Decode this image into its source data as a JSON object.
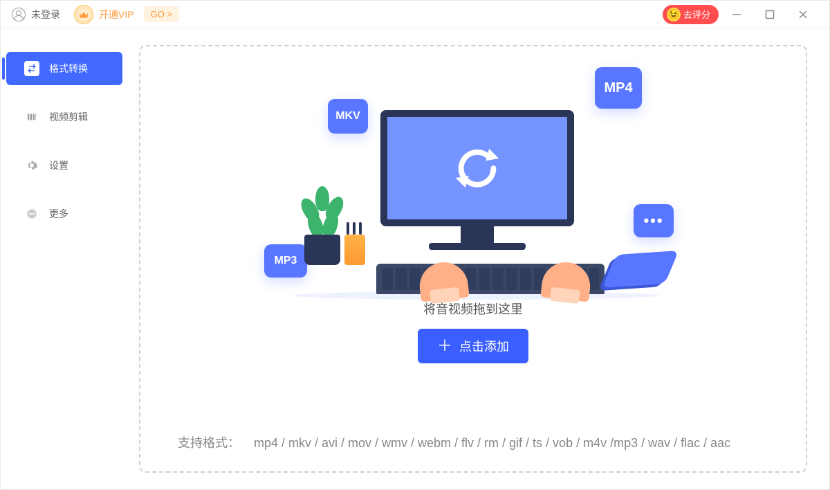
{
  "titlebar": {
    "login_status": "未登录",
    "vip_label": "开通VIP",
    "go_label": "GO >",
    "rate_label": "去评分"
  },
  "sidebar": {
    "items": [
      {
        "label": "格式转换"
      },
      {
        "label": "视频剪辑"
      },
      {
        "label": "设置"
      },
      {
        "label": "更多"
      }
    ]
  },
  "main": {
    "format_tags": {
      "mkv": "MKV",
      "mp4": "MP4",
      "mp3": "MP3",
      "more": "•••"
    },
    "drag_hint": "将音视频拖到这里",
    "add_button": "点击添加",
    "supported_label": "支持格式：",
    "supported_formats": "mp4 / mkv / avi / mov / wmv / webm / flv / rm / gif / ts / vob / m4v  /mp3 / wav / flac / aac"
  }
}
